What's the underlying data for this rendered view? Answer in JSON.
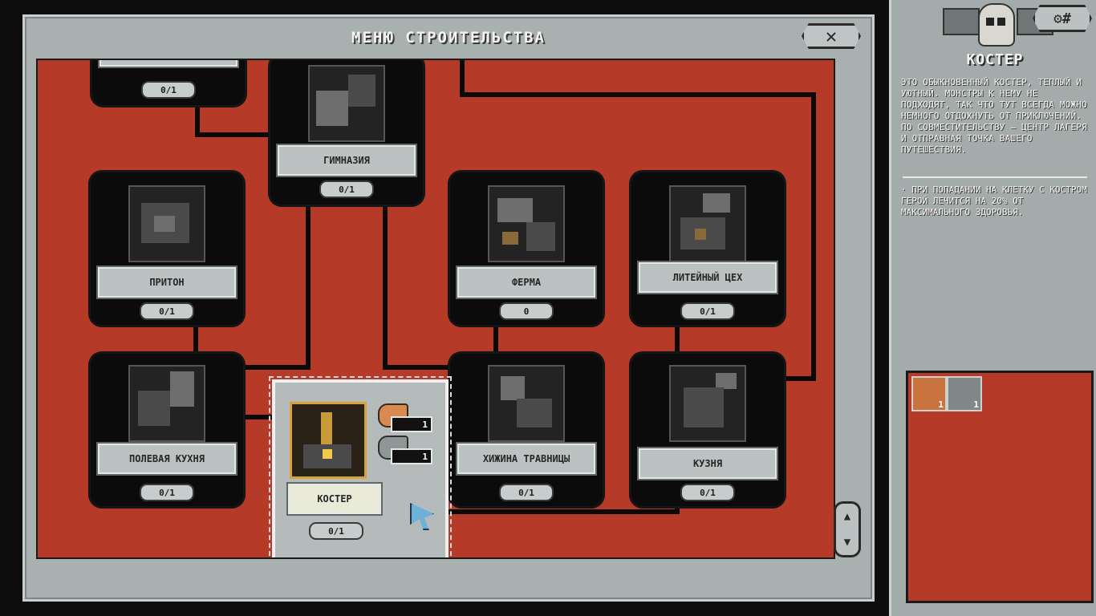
{
  "main_window": {
    "title": "МЕНЮ СТРОИТЕЛЬСТВА",
    "close_icon": "close-x-icon"
  },
  "buildings": [
    {
      "id": "top-left",
      "label": "",
      "counter": "0/1"
    },
    {
      "id": "gym",
      "label": "ГИМНАЗИЯ",
      "counter": "0/1"
    },
    {
      "id": "den",
      "label": "ПРИТОН",
      "counter": "0/1"
    },
    {
      "id": "farm",
      "label": "ФЕРМА",
      "counter": "0"
    },
    {
      "id": "foundry",
      "label": "ЛИТЕЙНЫЙ ЦЕХ",
      "counter": "0/1"
    },
    {
      "id": "field-kitchen",
      "label": "ПОЛЕВАЯ КУХНЯ",
      "counter": "0/1"
    },
    {
      "id": "herbalist",
      "label": "ХИЖИНА ТРАВНИЦЫ",
      "counter": "0/1"
    },
    {
      "id": "smithy",
      "label": "КУЗНЯ",
      "counter": "0/1"
    }
  ],
  "selected_building": {
    "label": "КОСТЕР",
    "counter": "0/1",
    "costs": [
      {
        "resource": "wood-icon",
        "amount": "1"
      },
      {
        "resource": "stone-icon",
        "amount": "1"
      }
    ]
  },
  "side_panel": {
    "title": "КОСТЕР",
    "description": "ЭТО ОБЫКНОВЕННЫЙ КОСТЕР, ТЕПЛЫЙ И УЮТНЫЙ. МОНСТРЫ К НЕМУ НЕ ПОДХОДЯТ, ТАК ЧТО ТУТ ВСЕГДА МОЖНО НЕМНОГО ОТДОХНУТЬ ОТ ПРИКЛЮЧЕНИЙ. ПО СОВМЕСТИТЕЛЬСТВУ – ЦЕНТР ЛАГЕРЯ И ОТПРАВНАЯ ТОЧКА ВАШЕГО ПУТЕШЕСТВИЯ.",
    "effect": "· ПРИ ПОПАДАНИИ НА КЛЕТКУ С КОСТРОМ ГЕРОЙ ЛЕЧИТСЯ НА 20% ОТ МАКСИМАЛЬНОГО ЗДОРОВЬЯ.",
    "settings_icon": "settings-gear-icon",
    "card_slots": [
      {
        "icon": "wood-card-icon",
        "count": "1"
      },
      {
        "icon": "stone-card-icon",
        "count": "1"
      }
    ]
  },
  "scroll": {
    "up": "▲",
    "down": "▼"
  },
  "colors": {
    "board": "#b63a28",
    "panel": "#a9b0b0",
    "card": "#0b0b0b"
  }
}
